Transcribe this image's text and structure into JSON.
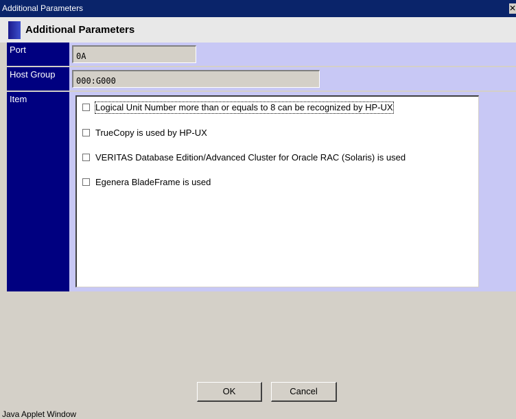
{
  "window": {
    "title": "Additional Parameters",
    "close_glyph": "✕",
    "footer": "Java Applet Window"
  },
  "header": {
    "title": "Additional Parameters"
  },
  "form": {
    "port_label": "Port",
    "port_value": "0A",
    "host_group_label": "Host Group",
    "host_group_value": "000:G000",
    "item_label": "Item",
    "items": [
      {
        "label": "Logical Unit Number more than or equals to 8 can be recognized by HP-UX",
        "checked": false
      },
      {
        "label": "TrueCopy is used by HP-UX",
        "checked": false
      },
      {
        "label": "VERITAS Database Edition/Advanced Cluster for Oracle RAC (Solaris) is used",
        "checked": false
      },
      {
        "label": "Egenera BladeFrame is used",
        "checked": false
      }
    ]
  },
  "buttons": {
    "ok": "OK",
    "cancel": "Cancel"
  },
  "colors": {
    "title_bar": "#0a246a",
    "label_bg": "#000080",
    "row_bg": "#c8c8f5"
  }
}
